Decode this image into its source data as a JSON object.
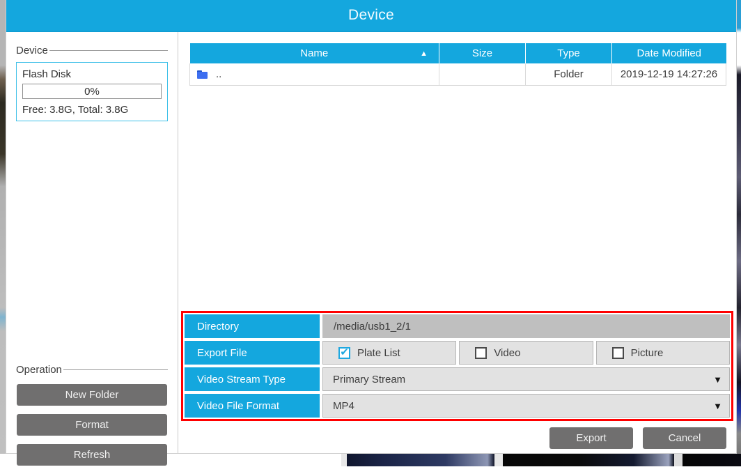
{
  "window": {
    "title": "Device"
  },
  "device_group": {
    "legend": "Device",
    "disk_name": "Flash Disk",
    "usage_percent_label": "0%",
    "usage_percent": 0,
    "capacity_text": "Free: 3.8G, Total: 3.8G"
  },
  "operation_group": {
    "legend": "Operation",
    "buttons": [
      {
        "label": "New Folder",
        "name": "new-folder-button"
      },
      {
        "label": "Format",
        "name": "format-button"
      },
      {
        "label": "Refresh",
        "name": "refresh-button"
      }
    ]
  },
  "file_list": {
    "columns": [
      {
        "label": "Name",
        "sorted": true,
        "sort_direction": "asc"
      },
      {
        "label": "Size",
        "sorted": false
      },
      {
        "label": "Type",
        "sorted": false
      },
      {
        "label": "Date Modified",
        "sorted": false
      }
    ],
    "sort_arrow_glyph": "▲",
    "rows": [
      {
        "icon": "folder-icon",
        "name": "..",
        "size": "",
        "type": "Folder",
        "date_modified": "2019-12-19 14:27:26"
      }
    ]
  },
  "settings": {
    "directory": {
      "label": "Directory",
      "value": "/media/usb1_2/1"
    },
    "export_file": {
      "label": "Export File",
      "options": [
        {
          "label": "Plate List",
          "checked": true
        },
        {
          "label": "Video",
          "checked": false
        },
        {
          "label": "Picture",
          "checked": false
        }
      ],
      "check_glyph": "✔"
    },
    "video_stream_type": {
      "label": "Video Stream Type",
      "value": "Primary Stream"
    },
    "video_file_format": {
      "label": "Video File Format",
      "value": "MP4"
    },
    "caret_glyph": "▼"
  },
  "footer": {
    "export_label": "Export",
    "cancel_label": "Cancel"
  },
  "colors": {
    "accent": "#14a7de",
    "highlight_border": "#ff0000",
    "button_gray": "#706f6f",
    "field_gray": "#bfbfbf",
    "select_gray": "#e2e2e2"
  }
}
